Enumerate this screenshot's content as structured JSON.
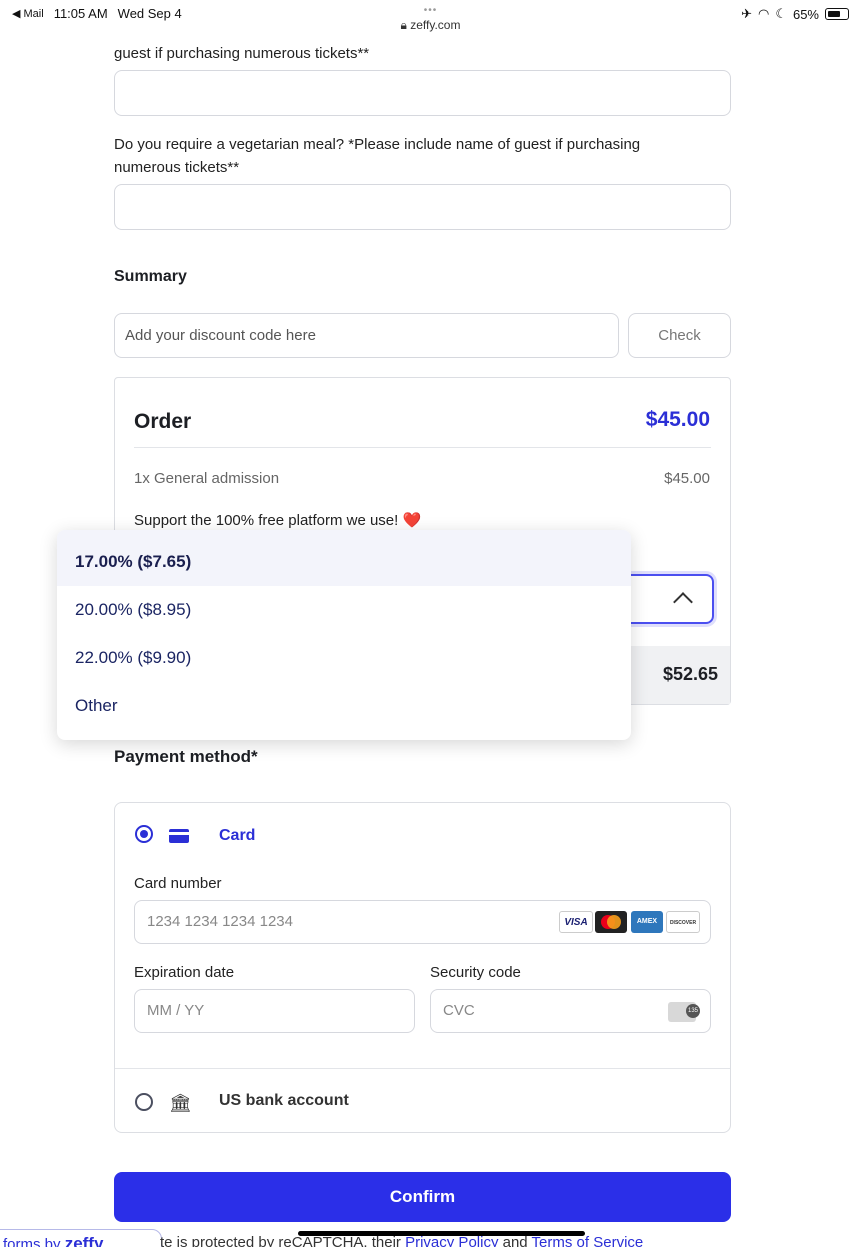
{
  "status_bar": {
    "back_app": "◀ Mail",
    "time": "11:05 AM",
    "date": "Wed Sep 4",
    "dots": "•••",
    "url": "zeffy.com",
    "battery": "65%"
  },
  "form": {
    "prev_question_tail": "guest if purchasing numerous tickets**",
    "vegetarian_question": "Do you require a vegetarian meal? *Please include name of guest if purchasing numerous tickets**"
  },
  "summary": {
    "title": "Summary",
    "discount_placeholder": "Add your discount code here",
    "check_label": "Check"
  },
  "order": {
    "title": "Order",
    "total": "$45.00",
    "line_item": "1x General admission",
    "line_price": "$45.00",
    "support_text": "Support the 100% free platform we use!",
    "heart": "❤️",
    "grand_total": "$52.65"
  },
  "tip_dropdown": {
    "options": [
      "17.00% ($7.65)",
      "20.00% ($8.95)",
      "22.00% ($9.90)",
      "Other"
    ],
    "selected_index": 0
  },
  "payment": {
    "title": "Payment method*",
    "card_label": "Card",
    "card_number_label": "Card number",
    "card_number_placeholder": "1234 1234 1234 1234",
    "card_brands": [
      "VISA",
      "MC",
      "AMEX",
      "DISCOVER"
    ],
    "expiration_label": "Expiration date",
    "expiration_placeholder": "MM / YY",
    "security_label": "Security code",
    "cvc_placeholder": "CVC",
    "bank_label": "US bank account",
    "accent_color": "#2b2fd6"
  },
  "confirm_label": "Confirm",
  "footer": {
    "badge_prefix": "forms by ",
    "badge_brand": "zeffy",
    "legal_prefix": "te is protected by reCAPTCHA, their ",
    "privacy": "Privacy Policy",
    "and": " and ",
    "terms": "Terms of Service"
  }
}
